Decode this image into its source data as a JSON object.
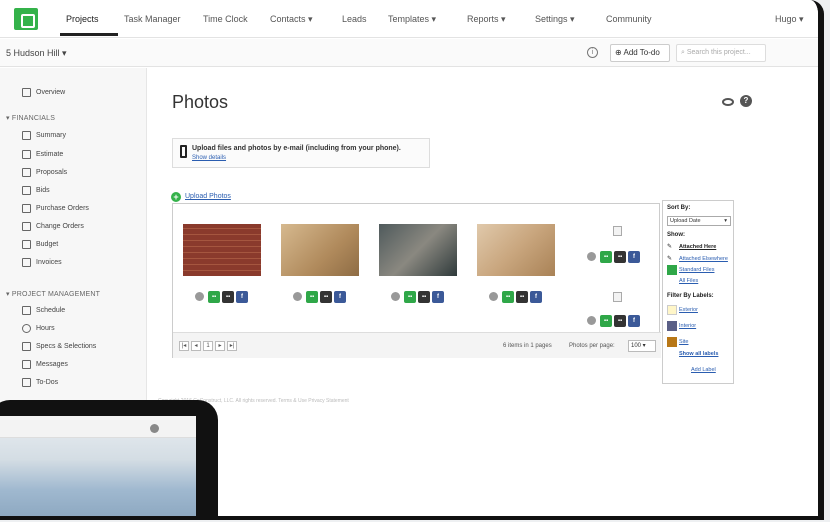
{
  "nav": {
    "items": [
      "Projects",
      "Task Manager",
      "Time Clock",
      "Contacts ▾",
      "Leads",
      "Templates ▾",
      "Reports ▾",
      "Settings ▾",
      "Community"
    ],
    "user": "Hugo ▾"
  },
  "subbar": {
    "project": "5 Hudson Hill ▾",
    "add_todo": "Add To-do",
    "search_placeholder": "Search this project..."
  },
  "sidebar": {
    "overview": "Overview",
    "financials_head": "▾ FINANCIALS",
    "financials": [
      "Summary",
      "Estimate",
      "Proposals",
      "Bids",
      "Purchase Orders",
      "Change Orders",
      "Budget",
      "Invoices"
    ],
    "pm_head": "▾ PROJECT MANAGEMENT",
    "pm": [
      "Schedule",
      "Hours",
      "Specs & Selections",
      "Messages",
      "To-Dos"
    ]
  },
  "main": {
    "title": "Photos",
    "upload_email": "Upload files and photos by e-mail (including from your phone).",
    "show_details": "Show details",
    "upload_photos": "Upload Photos",
    "items_text": "6 items in 1 pages",
    "per_page_label": "Photos per page:",
    "per_page_value": "100",
    "page_number": "1",
    "footer": "Copyright 2016 CoConstruct, LLC. All rights reserved. Terms & Use  Privacy Statement"
  },
  "filters": {
    "sort_by": "Sort By:",
    "sort_value": "Upload Date",
    "show": "Show:",
    "attached_here": "Attached Here",
    "attached_elsewhere": "Attached Elsewhere",
    "standard_files": "Standard Files",
    "all_files": "All Files",
    "filter_by_labels": "Filter By Labels:",
    "labels": [
      "Exterior",
      "Interior",
      "Site"
    ],
    "show_all_labels": "Show all labels",
    "add_label": "Add Label"
  },
  "colors": {
    "brand": "#34b24a",
    "link": "#2a5db0",
    "label_exterior": "#fff6c8",
    "label_interior": "#5a5f86",
    "label_site": "#b87716"
  }
}
